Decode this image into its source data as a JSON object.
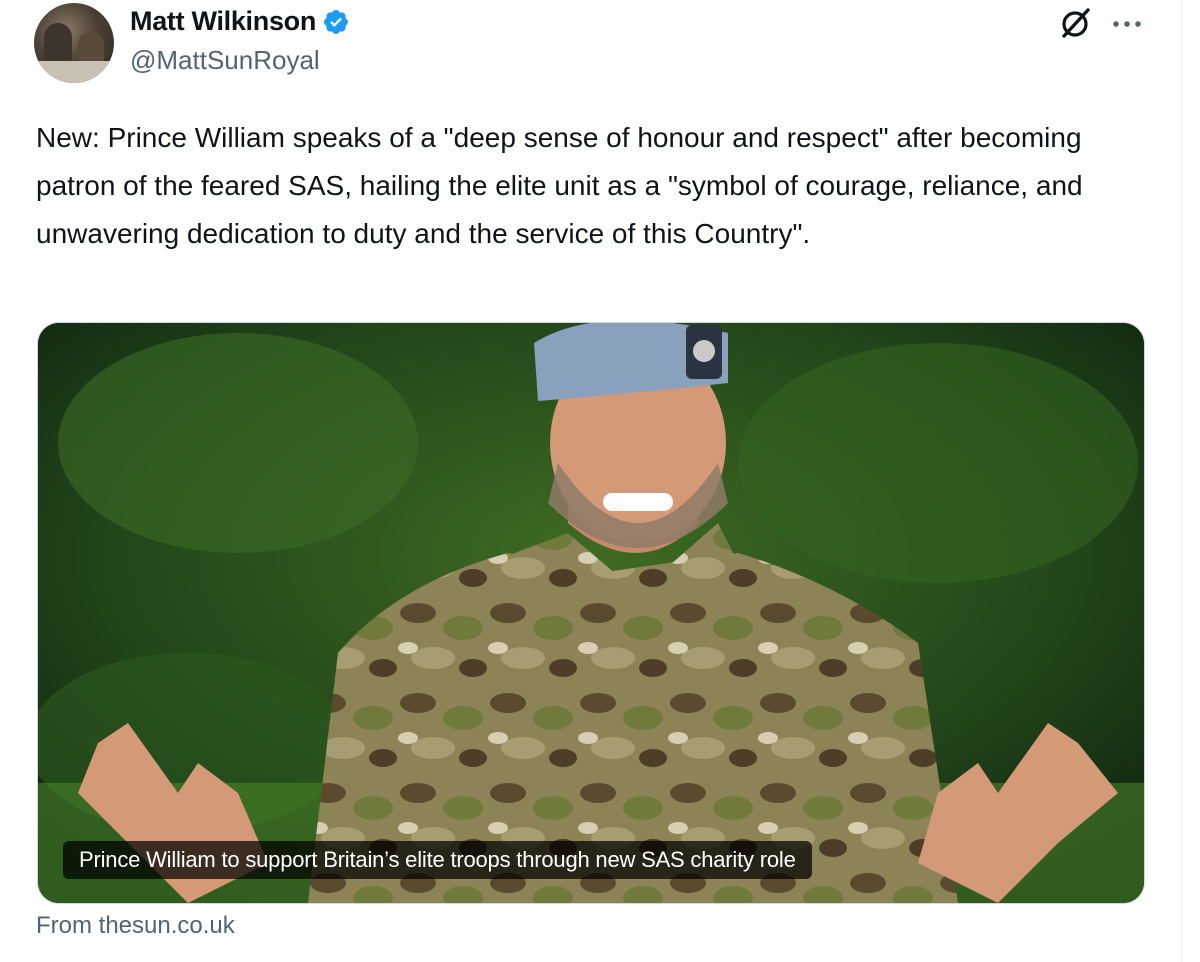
{
  "author": {
    "display_name": "Matt Wilkinson",
    "handle": "@MattSunRoyal",
    "verified": true,
    "verified_badge_color": "#1d9bf0",
    "avatar_icon": "profile-avatar"
  },
  "header_actions": {
    "grok_icon": "grok-icon",
    "more_icon": "more-options-icon"
  },
  "tweet": {
    "text": "New: Prince William speaks of a \"deep sense of honour and respect\" after becoming patron of the feared SAS, hailing the elite unit as a \"symbol of courage, reliance, and unwavering dedication to duty and the service of this Country\"."
  },
  "card": {
    "caption": "Prince William to support Britain’s elite troops through new SAS charity role",
    "source": "From thesun.co.uk"
  },
  "colors": {
    "text_primary": "#0f1419",
    "text_secondary": "#536471",
    "border": "#cfd9de"
  }
}
